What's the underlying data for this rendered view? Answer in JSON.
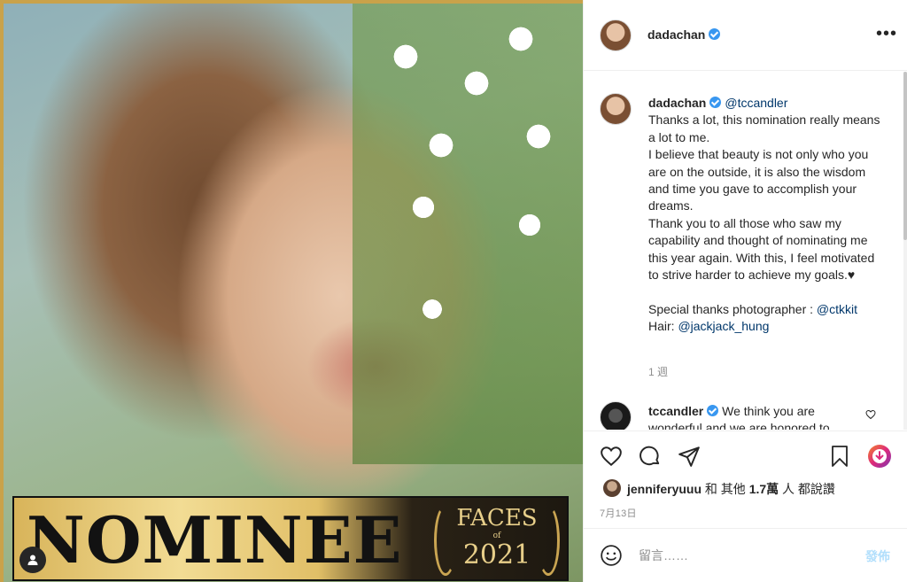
{
  "post": {
    "image": {
      "banner_text": "NOMINEE",
      "badge": {
        "word": "FACES",
        "of": "of",
        "year": "2021"
      }
    },
    "header": {
      "username": "dadachan",
      "verified": true,
      "more_label": "•••"
    },
    "caption": {
      "username": "dadachan",
      "mention": "@tccandler",
      "lines": [
        "Thanks a lot, this nomination really means a lot to me.",
        "I believe that beauty is not only who you are on the outside, it is also the wisdom and time you gave to accomplish your dreams.",
        "Thank you to all those who saw my capability and thought of nominating me this year again. With this, I feel motivated to strive harder to achieve my goals.♥"
      ],
      "credits": [
        {
          "prefix": "Special thanks photographer : ",
          "handle": "@ctkkit"
        },
        {
          "prefix": "Hair: ",
          "handle": "@jackjack_hung"
        }
      ],
      "time_ago": "1 週"
    },
    "reply": {
      "username": "tccandler",
      "text": "We think you are wonderful and we are honored to"
    },
    "likes": {
      "user": "jenniferyuuu",
      "rest_prefix": " 和 其他 ",
      "count": "1.7萬",
      "rest_suffix": " 人 都說讚"
    },
    "date": "7月13日",
    "composer": {
      "placeholder": "留言……",
      "post_label": "發佈"
    }
  },
  "icons": {
    "like": "heart-icon",
    "comment": "comment-icon",
    "share": "paper-plane-icon",
    "save": "bookmark-icon",
    "download": "download-extension-icon",
    "emoji": "smiley-icon",
    "user_tag": "user-tag-icon"
  },
  "colors": {
    "text": "#262626",
    "secondary": "#8e8e8e",
    "link": "#00376b",
    "verified": "#3897f0",
    "post_disabled": "#b2dffc",
    "frame_gold": "#c9a24a"
  }
}
